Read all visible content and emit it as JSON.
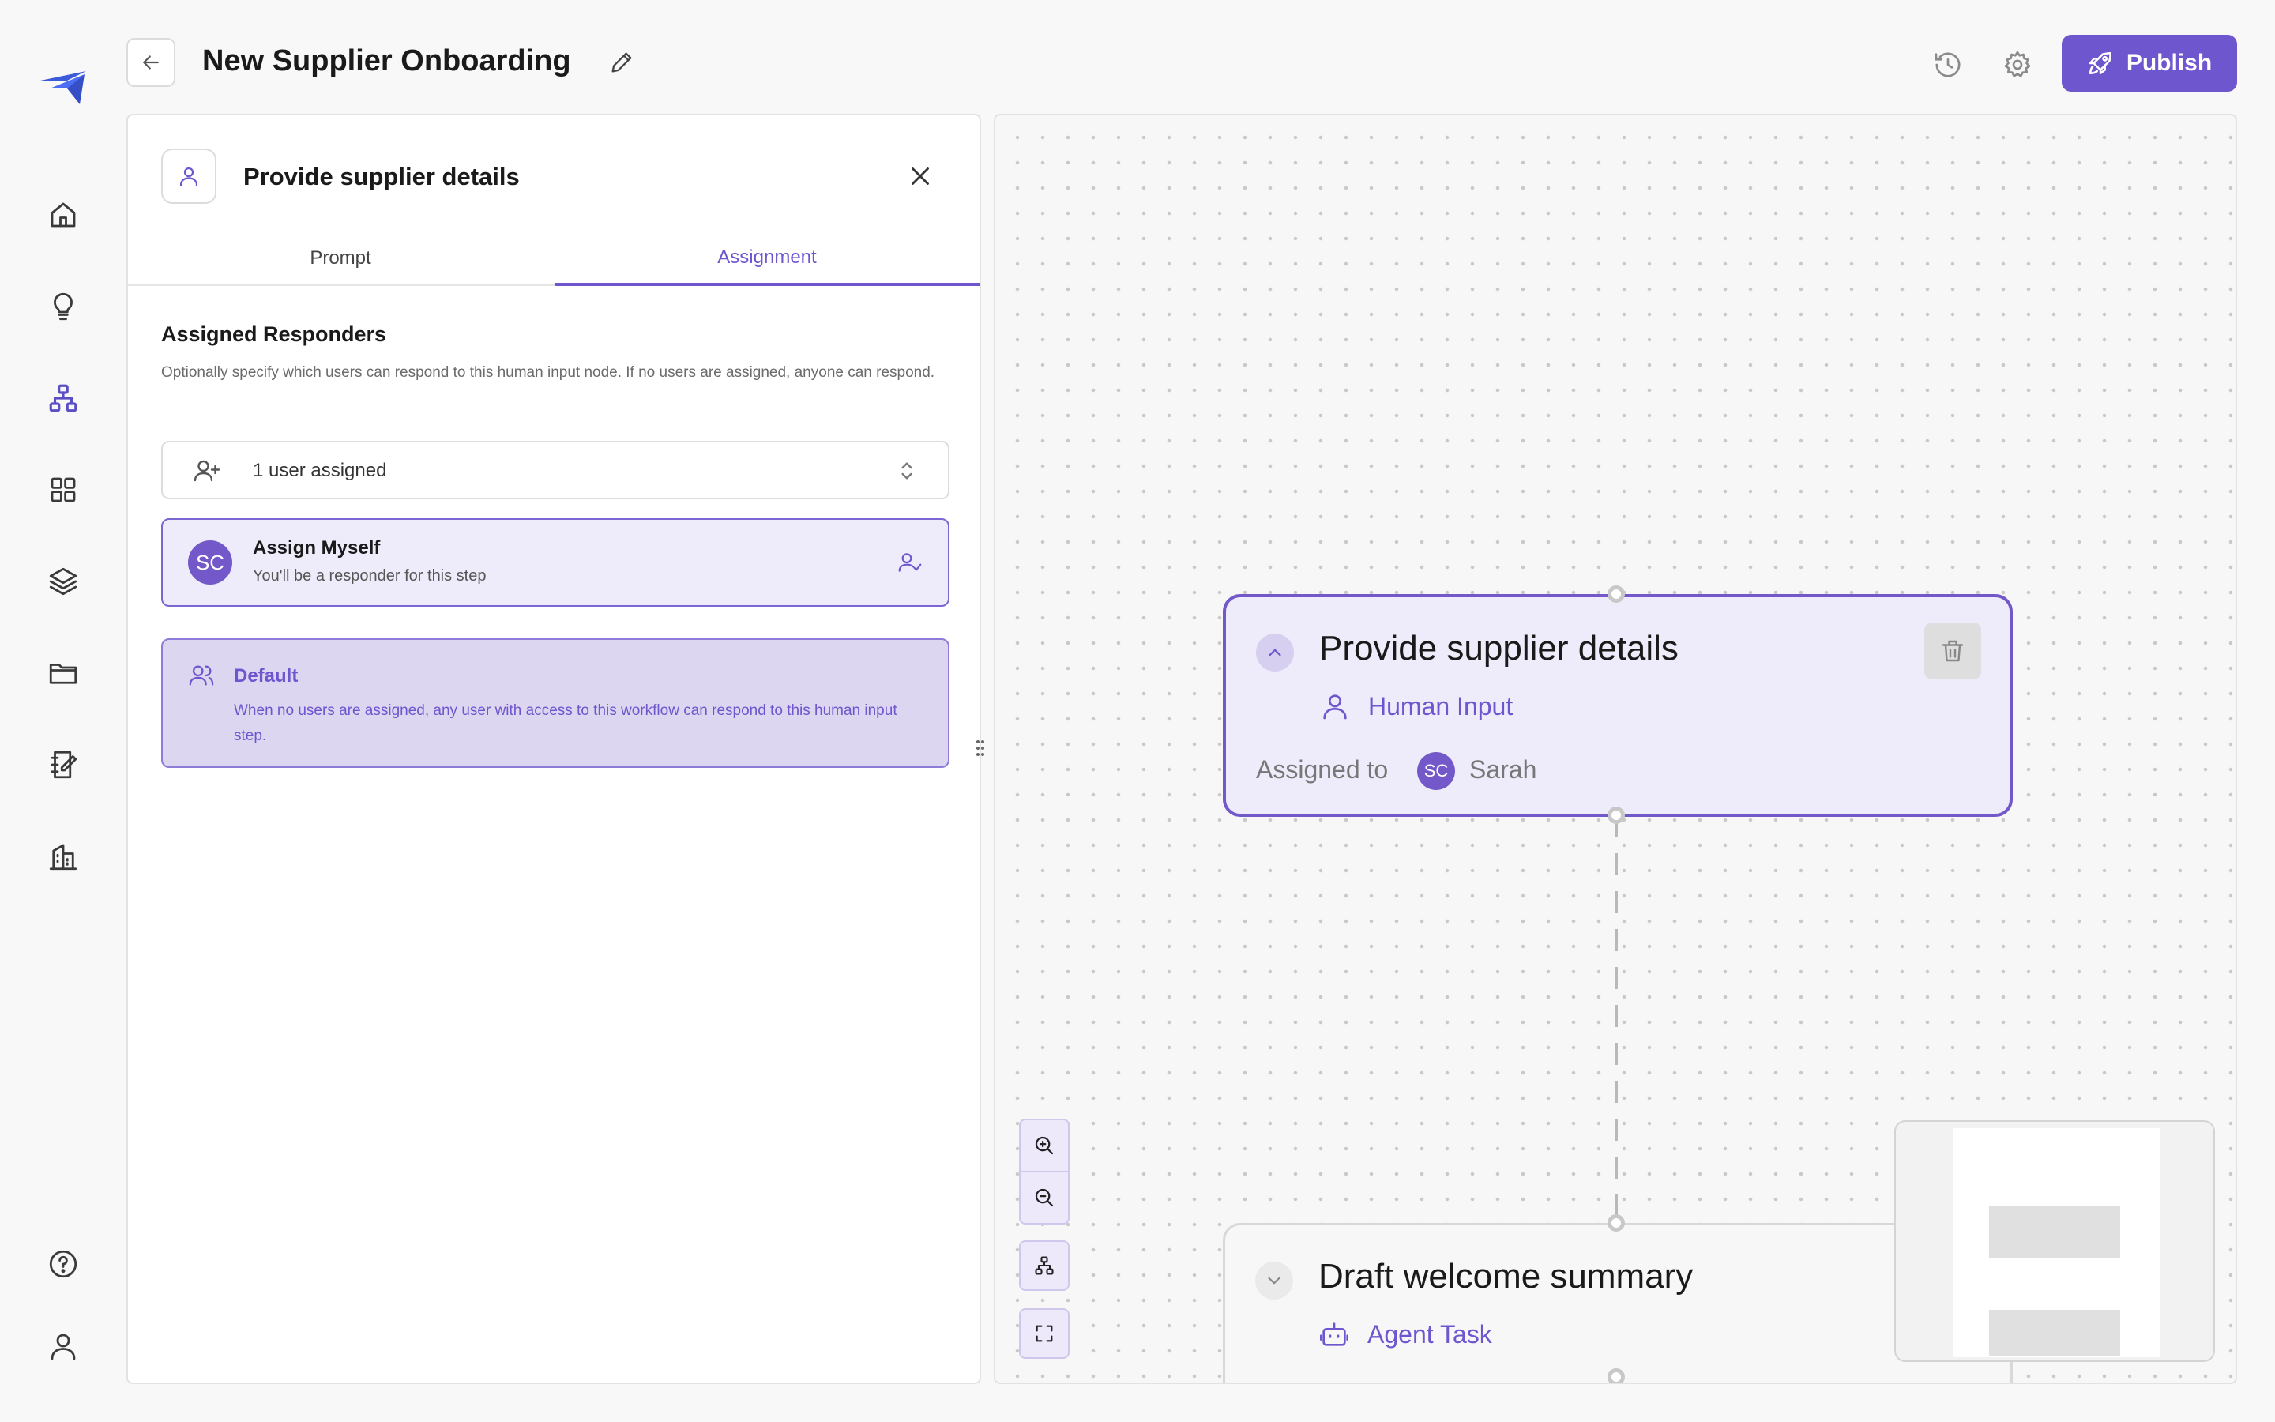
{
  "header": {
    "title": "New Supplier Onboarding",
    "publish_label": "Publish"
  },
  "sidebar": {
    "items": [
      {
        "name": "home-icon"
      },
      {
        "name": "lightbulb-icon"
      },
      {
        "name": "workflow-icon",
        "active": true
      },
      {
        "name": "grid-icon"
      },
      {
        "name": "layers-icon"
      },
      {
        "name": "folder-icon"
      },
      {
        "name": "notebook-icon"
      },
      {
        "name": "building-icon"
      },
      {
        "name": "help-icon"
      },
      {
        "name": "profile-icon"
      }
    ]
  },
  "panel": {
    "title": "Provide supplier details",
    "tabs": [
      {
        "label": "Prompt"
      },
      {
        "label": "Assignment",
        "active": true
      }
    ],
    "section_title": "Assigned Responders",
    "section_desc": "Optionally specify which users can respond to this human input node. If no users are assigned, anyone can respond.",
    "select_value": "1 user assigned",
    "assign_myself": {
      "initials": "SC",
      "title": "Assign Myself",
      "subtitle": "You'll be a responder for this step"
    },
    "default": {
      "title": "Default",
      "desc": "When no users are assigned, any user with access to this workflow can respond to this human input step."
    }
  },
  "canvas": {
    "nodes": [
      {
        "title": "Provide supplier details",
        "type": "Human Input",
        "assigned_label": "Assigned to",
        "assignee_initials": "SC",
        "assignee": "Sarah"
      },
      {
        "title": "Draft welcome summary",
        "type": "Agent Task"
      }
    ]
  },
  "colors": {
    "accent": "#6e56cf",
    "accent_light": "#eeebfa",
    "default_card": "#dcd6f0"
  }
}
